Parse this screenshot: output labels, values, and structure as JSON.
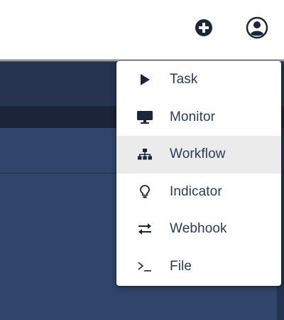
{
  "header": {
    "add_icon": "plus-circle-icon",
    "account_icon": "account-circle-icon"
  },
  "add_menu": {
    "highlighted_item": "Workflow",
    "items": [
      {
        "label": "Task",
        "icon": "play-icon"
      },
      {
        "label": "Monitor",
        "icon": "monitor-icon"
      },
      {
        "label": "Workflow",
        "icon": "sitemap-icon"
      },
      {
        "label": "Indicator",
        "icon": "lightbulb-icon"
      },
      {
        "label": "Webhook",
        "icon": "swap-arrows-icon"
      },
      {
        "label": "File",
        "icon": "terminal-prompt-icon"
      }
    ]
  },
  "colors": {
    "navy_dark": "#1b2537",
    "navy_header": "#263450",
    "navy_main": "#314469",
    "menu_text": "#2b3b58",
    "menu_highlight": "#ebebeb"
  }
}
